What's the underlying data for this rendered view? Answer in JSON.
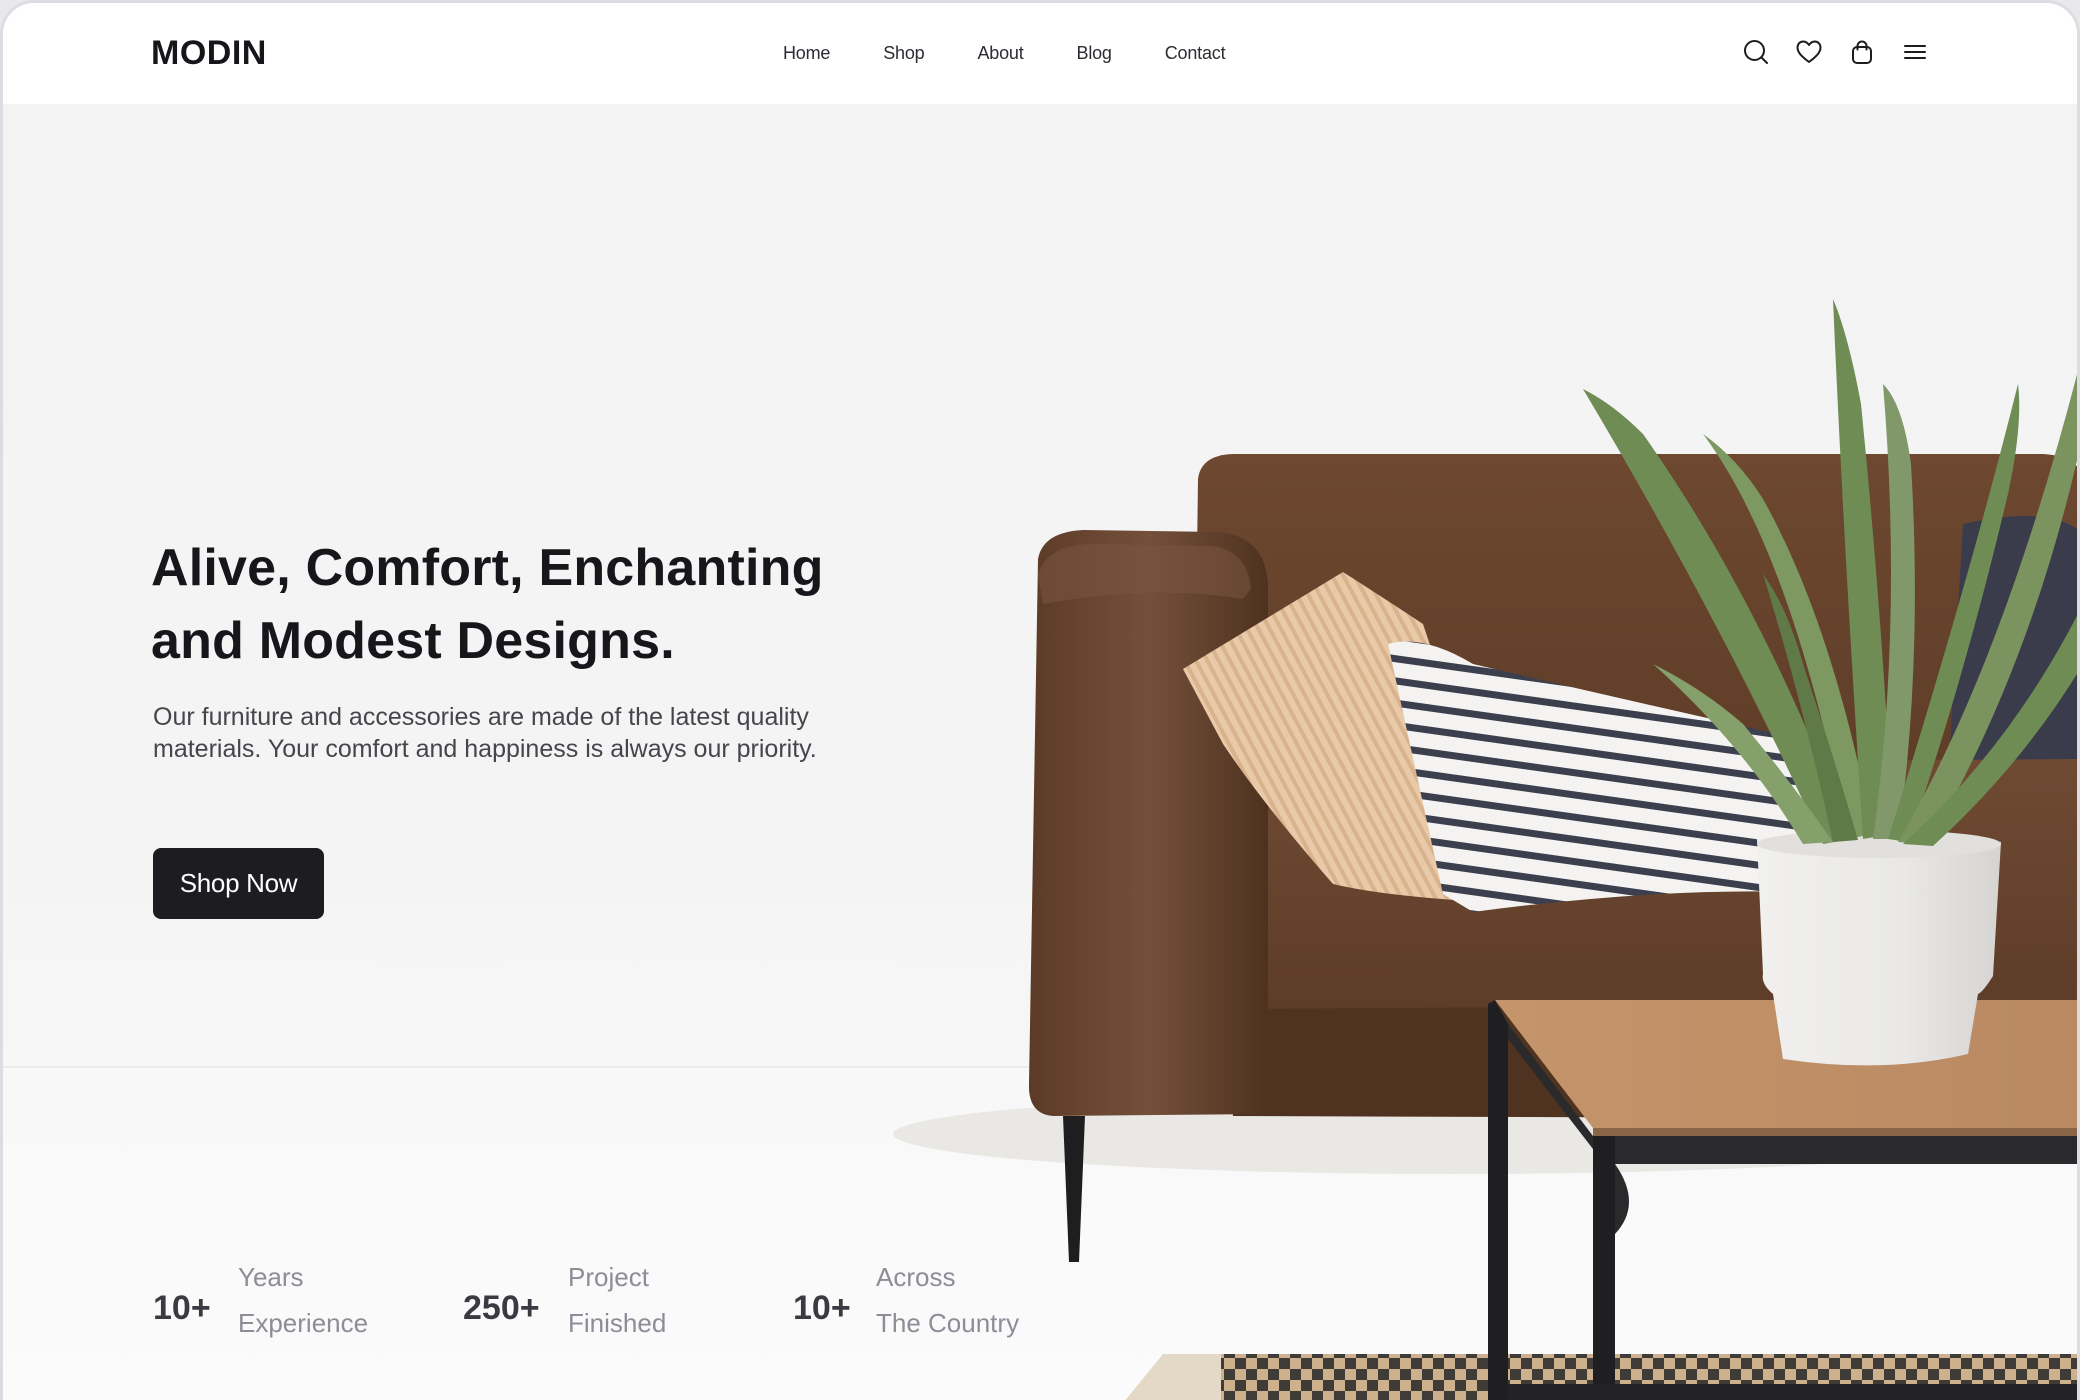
{
  "brand": {
    "logo": "MODIN"
  },
  "nav": {
    "items": [
      {
        "label": "Home"
      },
      {
        "label": "Shop"
      },
      {
        "label": "About"
      },
      {
        "label": "Blog"
      },
      {
        "label": "Contact"
      }
    ]
  },
  "header_icons": [
    "search-icon",
    "heart-icon",
    "bag-icon",
    "menu-icon"
  ],
  "hero": {
    "title_line1": "Alive, Comfort, Enchanting",
    "title_line2": "and Modest Designs.",
    "subtitle_line1": "Our furniture and accessories are made of the latest quality",
    "subtitle_line2": "materials. Your comfort and happiness is always our priority.",
    "cta_label": "Shop Now"
  },
  "stats": [
    {
      "value": "10+",
      "line1": "Years",
      "line2": "Experience"
    },
    {
      "value": "250+",
      "line1": "Project",
      "line2": "Finished"
    },
    {
      "value": "10+",
      "line1": "Across",
      "line2": "The Country"
    }
  ],
  "colors": {
    "primary_dark": "#1d1d21",
    "sofa_brown": "#6a442c",
    "table_wood": "#c8986e",
    "plant_green": "#6f8c55",
    "muted_text": "#8d8d97"
  }
}
